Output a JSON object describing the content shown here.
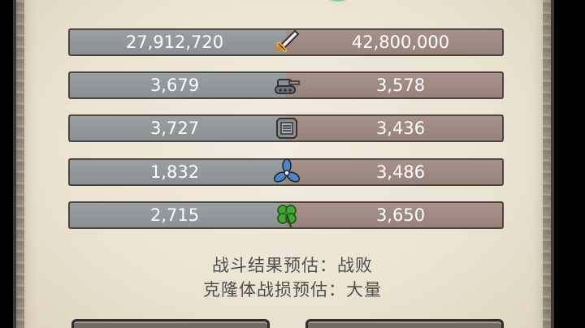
{
  "stats": [
    {
      "icon": "sword-icon",
      "left_value": "27,912,720",
      "right_value": "42,800,000"
    },
    {
      "icon": "tank-icon",
      "left_value": "3,679",
      "right_value": "3,578"
    },
    {
      "icon": "armor-plate-icon",
      "left_value": "3,727",
      "right_value": "3,436"
    },
    {
      "icon": "propeller-icon",
      "left_value": "1,832",
      "right_value": "3,486"
    },
    {
      "icon": "clover-icon",
      "left_value": "2,715",
      "right_value": "3,650"
    }
  ],
  "result": {
    "battle_outcome": "战斗结果预估：战败",
    "clone_losses": "克隆体战损预估：大量"
  },
  "colors": {
    "left_bar": "#8b9193",
    "right_bar": "#98837b",
    "panel": "#ebe4d2",
    "text_dark": "#4e4e4e"
  }
}
